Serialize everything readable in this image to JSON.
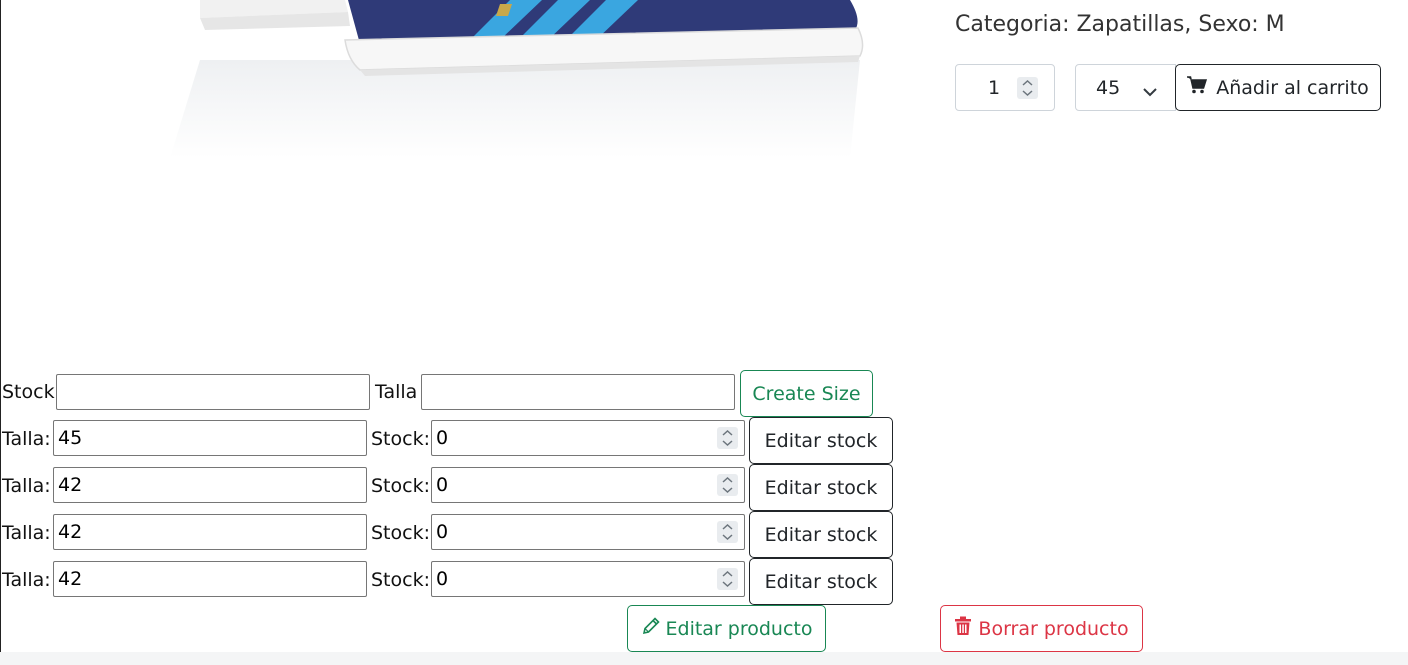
{
  "product": {
    "category_line": "Categoria: Zapatillas, Sexo: M",
    "quantity": "1",
    "selected_size": "45",
    "add_to_cart_label": "Añadir al carrito"
  },
  "create_size": {
    "stock_label": "Stock",
    "stock_value": "",
    "size_label": "Talla",
    "size_value": "",
    "button_label": "Create Size"
  },
  "stock_rows": [
    {
      "size_label": "Talla:",
      "size": "45",
      "stock_label": "Stock:",
      "stock": "0",
      "button_label": "Editar stock"
    },
    {
      "size_label": "Talla:",
      "size": "42",
      "stock_label": "Stock:",
      "stock": "0",
      "button_label": "Editar stock"
    },
    {
      "size_label": "Talla:",
      "size": "42",
      "stock_label": "Stock:",
      "stock": "0",
      "button_label": "Editar stock"
    },
    {
      "size_label": "Talla:",
      "size": "42",
      "stock_label": "Stock:",
      "stock": "0",
      "button_label": "Editar stock"
    }
  ],
  "actions": {
    "edit_product_label": "Editar producto",
    "delete_product_label": "Borrar producto"
  },
  "icons": {
    "cart": "cart-icon",
    "pencil": "pencil-icon",
    "trash": "trash-icon",
    "chevron": "chevron-down-icon",
    "spinner": "spinner-arrows-icon"
  },
  "colors": {
    "success": "#198754",
    "danger": "#dc3545",
    "dark": "#212529",
    "shoe_navy": "#2f3a78",
    "shoe_stripe": "#3aa6e0"
  }
}
